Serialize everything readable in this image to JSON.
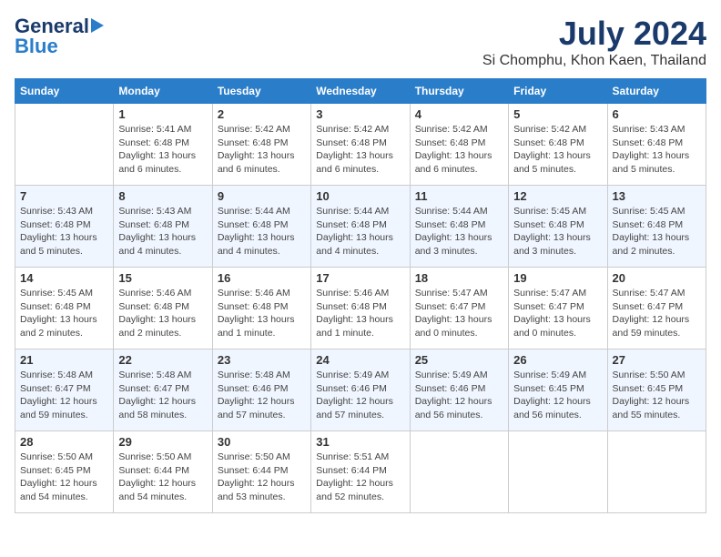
{
  "logo": {
    "line1": "General",
    "line2": "Blue"
  },
  "title": "July 2024",
  "location": "Si Chomphu, Khon Kaen, Thailand",
  "weekdays": [
    "Sunday",
    "Monday",
    "Tuesday",
    "Wednesday",
    "Thursday",
    "Friday",
    "Saturday"
  ],
  "weeks": [
    [
      {
        "day": null
      },
      {
        "day": "1",
        "sunrise": "Sunrise: 5:41 AM",
        "sunset": "Sunset: 6:48 PM",
        "daylight": "Daylight: 13 hours and 6 minutes."
      },
      {
        "day": "2",
        "sunrise": "Sunrise: 5:42 AM",
        "sunset": "Sunset: 6:48 PM",
        "daylight": "Daylight: 13 hours and 6 minutes."
      },
      {
        "day": "3",
        "sunrise": "Sunrise: 5:42 AM",
        "sunset": "Sunset: 6:48 PM",
        "daylight": "Daylight: 13 hours and 6 minutes."
      },
      {
        "day": "4",
        "sunrise": "Sunrise: 5:42 AM",
        "sunset": "Sunset: 6:48 PM",
        "daylight": "Daylight: 13 hours and 6 minutes."
      },
      {
        "day": "5",
        "sunrise": "Sunrise: 5:42 AM",
        "sunset": "Sunset: 6:48 PM",
        "daylight": "Daylight: 13 hours and 5 minutes."
      },
      {
        "day": "6",
        "sunrise": "Sunrise: 5:43 AM",
        "sunset": "Sunset: 6:48 PM",
        "daylight": "Daylight: 13 hours and 5 minutes."
      }
    ],
    [
      {
        "day": "7",
        "sunrise": "Sunrise: 5:43 AM",
        "sunset": "Sunset: 6:48 PM",
        "daylight": "Daylight: 13 hours and 5 minutes."
      },
      {
        "day": "8",
        "sunrise": "Sunrise: 5:43 AM",
        "sunset": "Sunset: 6:48 PM",
        "daylight": "Daylight: 13 hours and 4 minutes."
      },
      {
        "day": "9",
        "sunrise": "Sunrise: 5:44 AM",
        "sunset": "Sunset: 6:48 PM",
        "daylight": "Daylight: 13 hours and 4 minutes."
      },
      {
        "day": "10",
        "sunrise": "Sunrise: 5:44 AM",
        "sunset": "Sunset: 6:48 PM",
        "daylight": "Daylight: 13 hours and 4 minutes."
      },
      {
        "day": "11",
        "sunrise": "Sunrise: 5:44 AM",
        "sunset": "Sunset: 6:48 PM",
        "daylight": "Daylight: 13 hours and 3 minutes."
      },
      {
        "day": "12",
        "sunrise": "Sunrise: 5:45 AM",
        "sunset": "Sunset: 6:48 PM",
        "daylight": "Daylight: 13 hours and 3 minutes."
      },
      {
        "day": "13",
        "sunrise": "Sunrise: 5:45 AM",
        "sunset": "Sunset: 6:48 PM",
        "daylight": "Daylight: 13 hours and 2 minutes."
      }
    ],
    [
      {
        "day": "14",
        "sunrise": "Sunrise: 5:45 AM",
        "sunset": "Sunset: 6:48 PM",
        "daylight": "Daylight: 13 hours and 2 minutes."
      },
      {
        "day": "15",
        "sunrise": "Sunrise: 5:46 AM",
        "sunset": "Sunset: 6:48 PM",
        "daylight": "Daylight: 13 hours and 2 minutes."
      },
      {
        "day": "16",
        "sunrise": "Sunrise: 5:46 AM",
        "sunset": "Sunset: 6:48 PM",
        "daylight": "Daylight: 13 hours and 1 minute."
      },
      {
        "day": "17",
        "sunrise": "Sunrise: 5:46 AM",
        "sunset": "Sunset: 6:48 PM",
        "daylight": "Daylight: 13 hours and 1 minute."
      },
      {
        "day": "18",
        "sunrise": "Sunrise: 5:47 AM",
        "sunset": "Sunset: 6:47 PM",
        "daylight": "Daylight: 13 hours and 0 minutes."
      },
      {
        "day": "19",
        "sunrise": "Sunrise: 5:47 AM",
        "sunset": "Sunset: 6:47 PM",
        "daylight": "Daylight: 13 hours and 0 minutes."
      },
      {
        "day": "20",
        "sunrise": "Sunrise: 5:47 AM",
        "sunset": "Sunset: 6:47 PM",
        "daylight": "Daylight: 12 hours and 59 minutes."
      }
    ],
    [
      {
        "day": "21",
        "sunrise": "Sunrise: 5:48 AM",
        "sunset": "Sunset: 6:47 PM",
        "daylight": "Daylight: 12 hours and 59 minutes."
      },
      {
        "day": "22",
        "sunrise": "Sunrise: 5:48 AM",
        "sunset": "Sunset: 6:47 PM",
        "daylight": "Daylight: 12 hours and 58 minutes."
      },
      {
        "day": "23",
        "sunrise": "Sunrise: 5:48 AM",
        "sunset": "Sunset: 6:46 PM",
        "daylight": "Daylight: 12 hours and 57 minutes."
      },
      {
        "day": "24",
        "sunrise": "Sunrise: 5:49 AM",
        "sunset": "Sunset: 6:46 PM",
        "daylight": "Daylight: 12 hours and 57 minutes."
      },
      {
        "day": "25",
        "sunrise": "Sunrise: 5:49 AM",
        "sunset": "Sunset: 6:46 PM",
        "daylight": "Daylight: 12 hours and 56 minutes."
      },
      {
        "day": "26",
        "sunrise": "Sunrise: 5:49 AM",
        "sunset": "Sunset: 6:45 PM",
        "daylight": "Daylight: 12 hours and 56 minutes."
      },
      {
        "day": "27",
        "sunrise": "Sunrise: 5:50 AM",
        "sunset": "Sunset: 6:45 PM",
        "daylight": "Daylight: 12 hours and 55 minutes."
      }
    ],
    [
      {
        "day": "28",
        "sunrise": "Sunrise: 5:50 AM",
        "sunset": "Sunset: 6:45 PM",
        "daylight": "Daylight: 12 hours and 54 minutes."
      },
      {
        "day": "29",
        "sunrise": "Sunrise: 5:50 AM",
        "sunset": "Sunset: 6:44 PM",
        "daylight": "Daylight: 12 hours and 54 minutes."
      },
      {
        "day": "30",
        "sunrise": "Sunrise: 5:50 AM",
        "sunset": "Sunset: 6:44 PM",
        "daylight": "Daylight: 12 hours and 53 minutes."
      },
      {
        "day": "31",
        "sunrise": "Sunrise: 5:51 AM",
        "sunset": "Sunset: 6:44 PM",
        "daylight": "Daylight: 12 hours and 52 minutes."
      },
      {
        "day": null
      },
      {
        "day": null
      },
      {
        "day": null
      }
    ]
  ]
}
